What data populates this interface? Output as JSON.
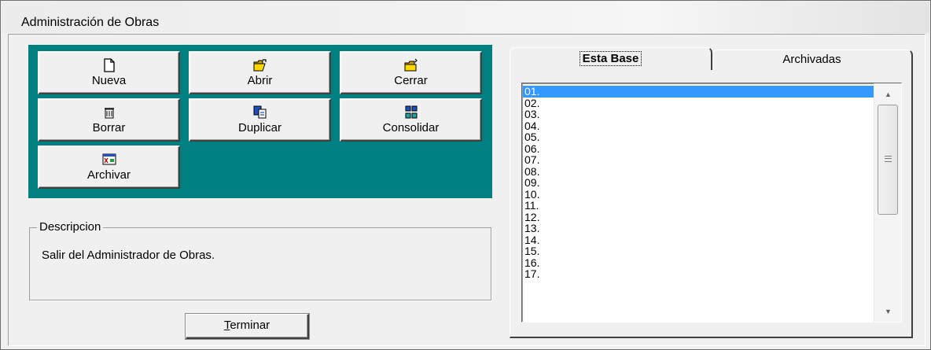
{
  "window": {
    "title": "Administración de Obras"
  },
  "toolbar": {
    "buttons": [
      {
        "label": "Nueva",
        "icon": "new-document-icon"
      },
      {
        "label": "Abrir",
        "icon": "open-folder-icon"
      },
      {
        "label": "Cerrar",
        "icon": "close-folder-icon"
      },
      {
        "label": "Borrar",
        "icon": "trash-icon"
      },
      {
        "label": "Duplicar",
        "icon": "duplicate-icon"
      },
      {
        "label": "Consolidar",
        "icon": "consolidate-icon"
      },
      {
        "label": "Archivar",
        "icon": "archive-icon"
      }
    ],
    "panel_color": "#008080"
  },
  "description": {
    "legend": "Descripcion",
    "text": "Salir del Administrador de Obras."
  },
  "terminar": {
    "prefix": "",
    "accel": "T",
    "rest": "erminar"
  },
  "tabs": [
    {
      "label": "Esta Base",
      "active": true
    },
    {
      "label": "Archivadas",
      "active": false
    }
  ],
  "list": {
    "items": [
      "01.",
      "02.",
      "03.",
      "04.",
      "05.",
      "06.",
      "07.",
      "08.",
      "09.",
      "10.",
      "11.",
      "12.",
      "13.",
      "14.",
      "15.",
      "16.",
      "17."
    ],
    "selected_index": 0,
    "selection_color": "#3399ff"
  }
}
